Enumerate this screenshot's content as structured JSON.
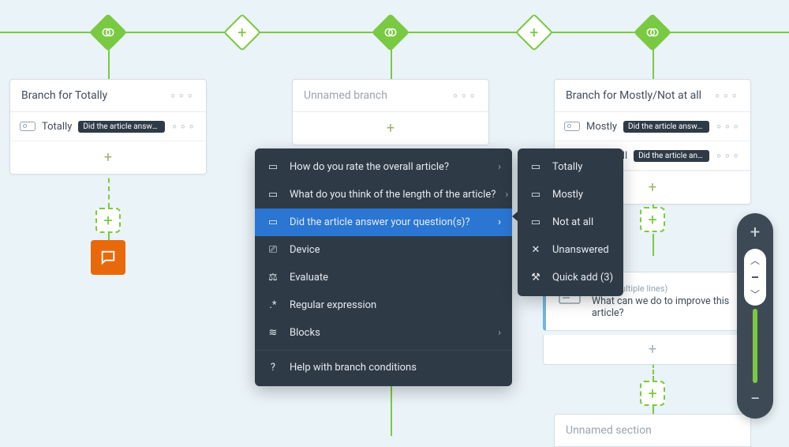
{
  "colors": {
    "accent": "#7ac943",
    "menu_bg": "#2e3b47",
    "menu_active": "#2a76d2",
    "chat": "#e8690b"
  },
  "branches": {
    "left": {
      "title": "Branch for Totally",
      "rows": [
        {
          "label": "Totally",
          "pill": "Did the article answer yo"
        }
      ]
    },
    "center": {
      "title": "Unnamed branch"
    },
    "right": {
      "title": "Branch for Mostly/Not at all",
      "rows": [
        {
          "label": "Mostly",
          "pill": "Did the article answer yo"
        },
        {
          "label": "Not at all",
          "pill": "Did the article answer"
        }
      ]
    }
  },
  "text_block": {
    "type_label": "Text (multiple lines)",
    "question": "What can we do to improve this article?"
  },
  "section": {
    "title": "Unnamed section"
  },
  "menu_main": {
    "items": [
      {
        "icon": "scale-icon",
        "label": "How do you rate the overall article?",
        "has_sub": true,
        "active": false
      },
      {
        "icon": "scale-icon",
        "label": "What do you think of the length of the article?",
        "has_sub": true,
        "active": false
      },
      {
        "icon": "scale-icon",
        "label": "Did the article answer your question(s)?",
        "has_sub": true,
        "active": true
      },
      {
        "icon": "device-icon",
        "label": "Device",
        "has_sub": false,
        "active": false
      },
      {
        "icon": "evaluate-icon",
        "label": "Evaluate",
        "has_sub": false,
        "active": false
      },
      {
        "icon": "regex-icon",
        "label": "Regular expression",
        "has_sub": false,
        "active": false
      },
      {
        "icon": "blocks-icon",
        "label": "Blocks",
        "has_sub": true,
        "active": false
      },
      {
        "icon": "help-icon",
        "label": "Help with branch conditions",
        "has_sub": false,
        "active": false,
        "sep_before": true
      }
    ]
  },
  "menu_sub": {
    "items": [
      {
        "icon": "scale-icon",
        "label": "Totally"
      },
      {
        "icon": "scale-icon",
        "label": "Mostly"
      },
      {
        "icon": "scale-icon",
        "label": "Not at all"
      },
      {
        "icon": "close-icon",
        "label": "Unanswered"
      },
      {
        "icon": "quickadd-icon",
        "label": "Quick add (3)"
      }
    ]
  }
}
